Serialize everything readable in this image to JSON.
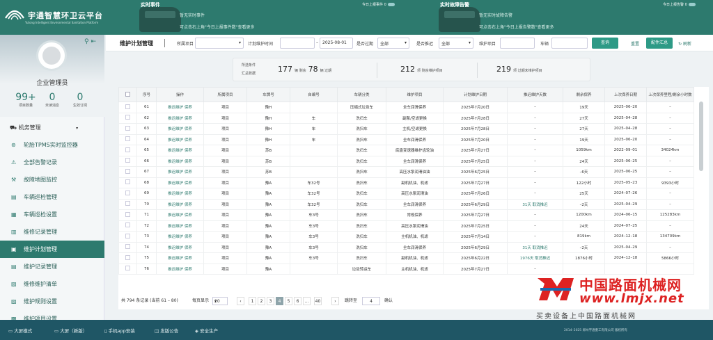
{
  "app": {
    "title": "宇通智慧环卫云平台",
    "subtitle": "Yutong Intelligent Environmental Sanitation Platform"
  },
  "event_panel": {
    "title": "实时事件",
    "right_label": "今日上报事件",
    "count": "0",
    "line1": "暂无实时事件",
    "line2": "可点击右上角\"今日上报事件数\"查看更多"
  },
  "alarm_panel": {
    "title": "实时故障告警",
    "right_label": "今日上报告警",
    "count": "0",
    "line1": "暂无实时故障告警",
    "line2": "可点击右上角\"今日上报告警数\"查看更多"
  },
  "sidebar": {
    "user": "企业管理员",
    "stats": [
      {
        "value": "99+",
        "label": "项目数量"
      },
      {
        "value": "0",
        "label": "未读消息"
      },
      {
        "value": "0",
        "label": "生效订阅"
      }
    ],
    "group": "机务管理",
    "items": [
      {
        "label": "轮胎TPMS实时监控器",
        "icon": "gauge-icon"
      },
      {
        "label": "全部告警记录",
        "icon": "alert-icon"
      },
      {
        "label": "故障地图监控",
        "icon": "map-icon"
      },
      {
        "label": "车辆巡检管理",
        "icon": "document-icon"
      },
      {
        "label": "车辆巡检设置",
        "icon": "settings-icon"
      },
      {
        "label": "维修记录管理",
        "icon": "wrench-icon"
      },
      {
        "label": "维护计划管理",
        "icon": "calendar-icon",
        "active": true
      },
      {
        "label": "维护记录管理",
        "icon": "list-icon"
      },
      {
        "label": "维修维护清单",
        "icon": "checklist-icon"
      },
      {
        "label": "维护规则设置",
        "icon": "rules-icon"
      },
      {
        "label": "维护项目设置",
        "icon": "item-icon"
      }
    ]
  },
  "toolbar": {
    "page_title": "维护计划管理",
    "filters": {
      "project_label": "所属项目",
      "plan_time_label": "计划维护时间",
      "date_end": "2025-08-01",
      "overdue_label": "是否过期",
      "overdue_value": "全部",
      "extended_label": "是否推迟",
      "extended_value": "全部",
      "item_label": "维护项目",
      "vehicle_label": "车辆"
    },
    "query_button": "查询",
    "reset_link": "重置",
    "summary_button": "配件汇总",
    "refresh_link": "刷新"
  },
  "summary": {
    "label1": "所选条件",
    "label2": "汇总数据",
    "vehicles": "177",
    "vehicles_unit": "辆 剩余",
    "overdue": "78",
    "overdue_unit": "辆 过期",
    "remaining_items": "212",
    "remaining_items_unit": "项 剩余维护项目",
    "overdue_items": "219",
    "overdue_items_unit": "项 过期未维护项目"
  },
  "table": {
    "headers": [
      "序号",
      "操作",
      "所属项目",
      "车牌号",
      "自编号",
      "车辆分类",
      "维护项目",
      "计划维护日期",
      "推迟维护天数",
      "剩余保养",
      "上次保养日期",
      "上次保养里程/剩余小时数"
    ],
    "rows": [
      [
        "61",
        "推迟维护  保养",
        "项目",
        "豫H",
        "",
        "压缩式垃圾车",
        "全车润滑保养",
        "2025年7月20日",
        "–",
        "19天",
        "2025–06–20",
        "–"
      ],
      [
        "62",
        "推迟维护  保养",
        "项目",
        "豫H",
        "车",
        "洗扫车",
        "副泵/空滤更换",
        "2025年7月28日",
        "–",
        "27天",
        "2025–04–28",
        "–"
      ],
      [
        "63",
        "推迟维护  保养",
        "项目",
        "豫H",
        "车",
        "洗扫车",
        "主机/空滤更换",
        "2025年7月28日",
        "–",
        "27天",
        "2025–04–28",
        "–"
      ],
      [
        "64",
        "推迟维护  保养",
        "项目",
        "豫H",
        "车",
        "洗扫车",
        "全车润滑保养",
        "2025年7月20日",
        "–",
        "19天",
        "2025–06–20",
        "–"
      ],
      [
        "65",
        "推迟维护  保养",
        "项目",
        "苏B",
        "",
        "洗扫车",
        "底盘变速器维护齿轮油",
        "2025年7月27日",
        "–",
        "1059km",
        "2022–09–01",
        "34024km"
      ],
      [
        "66",
        "推迟维护  保养",
        "项目",
        "苏B",
        "",
        "洗扫车",
        "全车润滑保养",
        "2025年7月25日",
        "–",
        "24天",
        "2025–06–25",
        "–"
      ],
      [
        "67",
        "推迟维护  保养",
        "项目",
        "苏B",
        "",
        "洗扫车",
        "高压水泵润滑油油",
        "2025年6月25日",
        "–",
        "–6天",
        "2025–06–25",
        "–"
      ],
      [
        "68",
        "推迟维护  保养",
        "项目",
        "豫A",
        "车32号",
        "洗扫车",
        "副机机油、机滤",
        "2025年7月27日",
        "–",
        "122小时",
        "2025–05–23",
        "9393小时"
      ],
      [
        "69",
        "推迟维护  保养",
        "项目",
        "豫A",
        "车32号",
        "洗扫车",
        "高压水泵润滑油",
        "2025年7月26日",
        "–",
        "25天",
        "2024–07–26",
        "–"
      ],
      [
        "70",
        "推迟维护  保养",
        "项目",
        "豫A",
        "车32号",
        "洗扫车",
        "全车润滑保养",
        "2025年6月29日",
        "31天 取消推迟",
        "–2天",
        "2025–04–29",
        "–"
      ],
      [
        "71",
        "推迟维护  保养",
        "项目",
        "豫A",
        "车3号",
        "洗扫车",
        "常规保养",
        "2025年7月27日",
        "–",
        "1200km",
        "2024–06–15",
        "125283km"
      ],
      [
        "72",
        "推迟维护  保养",
        "项目",
        "豫A",
        "车3号",
        "洗扫车",
        "高压水泵润滑油",
        "2025年7月25日",
        "–",
        "24天",
        "2024–07–25",
        "–"
      ],
      [
        "73",
        "推迟维护  保养",
        "项目",
        "豫A",
        "车3号",
        "洗扫车",
        "主机机油、机滤",
        "2025年7月14日",
        "–",
        "819km",
        "2024–12–18",
        "134709km"
      ],
      [
        "74",
        "推迟维护  保养",
        "项目",
        "豫A",
        "车3号",
        "洗扫车",
        "全车润滑保养",
        "2025年6月29日",
        "31天 取消推迟",
        "–2天",
        "2025–04–29",
        "–"
      ],
      [
        "75",
        "推迟维护  保养",
        "项目",
        "豫A",
        "车3号",
        "洗扫车",
        "副机机油、机滤",
        "2025年6月22日",
        "1976天 取消推迟",
        "1876小时",
        "2024–12–18",
        "5866小时"
      ],
      [
        "76",
        "推迟维护  保养",
        "项目",
        "豫A",
        "",
        "垃圾转运车",
        "主机机油、机滤",
        "2025年7月27日",
        "–",
        "",
        "",
        ""
      ]
    ]
  },
  "pagination": {
    "total": "共 794 条记录 (当前 61 – 80)",
    "per_page_label": "每页显示",
    "per_page": "20",
    "pages": [
      "1",
      "2",
      "3",
      "4",
      "5",
      "6",
      "...",
      "40"
    ],
    "current": "4",
    "goto_label": "跳转至",
    "goto_value": "4",
    "confirm": "确认"
  },
  "bottombar": {
    "items": [
      "大屏模式",
      "大屏（新版）",
      "手机app安装",
      "发版公告",
      "安全生产"
    ],
    "copyright": "2014–2025  郑州宇通重工有限公司  版权所有"
  },
  "watermark": {
    "cn": "中国路面机械网",
    "url": "www.lmjx.net",
    "tagline": "买卖设备上中国路面机械网"
  }
}
